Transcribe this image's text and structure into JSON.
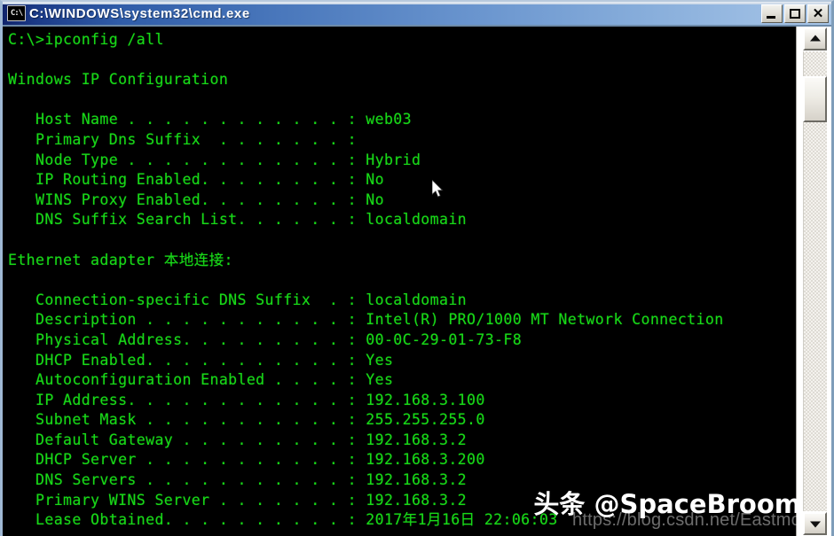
{
  "window": {
    "title": "C:\\WINDOWS\\system32\\cmd.exe",
    "icon_label": "C:\\",
    "buttons": {
      "minimize": "Minimize",
      "maximize": "Maximize",
      "close": "✕"
    }
  },
  "console": {
    "prompt_line": "C:\\>ipconfig /all",
    "text": "C:\\>ipconfig /all\n\nWindows IP Configuration\n\n   Host Name . . . . . . . . . . . . : web03\n   Primary Dns Suffix  . . . . . . . :\n   Node Type . . . . . . . . . . . . : Hybrid\n   IP Routing Enabled. . . . . . . . : No\n   WINS Proxy Enabled. . . . . . . . : No\n   DNS Suffix Search List. . . . . . : localdomain\n\nEthernet adapter 本地连接:\n\n   Connection-specific DNS Suffix  . : localdomain\n   Description . . . . . . . . . . . : Intel(R) PRO/1000 MT Network Connection\n   Physical Address. . . . . . . . . : 00-0C-29-01-73-F8\n   DHCP Enabled. . . . . . . . . . . : Yes\n   Autoconfiguration Enabled . . . . : Yes\n   IP Address. . . . . . . . . . . . : 192.168.3.100\n   Subnet Mask . . . . . . . . . . . : 255.255.255.0\n   Default Gateway . . . . . . . . . : 192.168.3.2\n   DHCP Server . . . . . . . . . . . : 192.168.3.200\n   DNS Servers . . . . . . . . . . . : 192.168.3.2\n   Primary WINS Server . . . . . . . : 192.168.3.2\n   Lease Obtained. . . . . . . . . . : 2017年1月16日 22:06:03",
    "command": "ipconfig /all",
    "section_titles": [
      "Windows IP Configuration",
      "Ethernet adapter 本地连接:"
    ],
    "ip_configuration": [
      {
        "label": "Host Name",
        "value": "web03"
      },
      {
        "label": "Primary Dns Suffix",
        "value": ""
      },
      {
        "label": "Node Type",
        "value": "Hybrid"
      },
      {
        "label": "IP Routing Enabled",
        "value": "No"
      },
      {
        "label": "WINS Proxy Enabled",
        "value": "No"
      },
      {
        "label": "DNS Suffix Search List",
        "value": "localdomain"
      }
    ],
    "ethernet_adapter": [
      {
        "label": "Connection-specific DNS Suffix",
        "value": "localdomain"
      },
      {
        "label": "Description",
        "value": "Intel(R) PRO/1000 MT Network Connection"
      },
      {
        "label": "Physical Address",
        "value": "00-0C-29-01-73-F8"
      },
      {
        "label": "DHCP Enabled",
        "value": "Yes"
      },
      {
        "label": "Autoconfiguration Enabled",
        "value": "Yes"
      },
      {
        "label": "IP Address",
        "value": "192.168.3.100"
      },
      {
        "label": "Subnet Mask",
        "value": "255.255.255.0"
      },
      {
        "label": "Default Gateway",
        "value": "192.168.3.2"
      },
      {
        "label": "DHCP Server",
        "value": "192.168.3.200"
      },
      {
        "label": "DNS Servers",
        "value": "192.168.3.2"
      },
      {
        "label": "Primary WINS Server",
        "value": "192.168.3.2"
      },
      {
        "label": "Lease Obtained",
        "value": "2017年1月16日 22:06:03"
      }
    ],
    "colors": {
      "background": "#000000",
      "text": "#18d818"
    }
  },
  "scrollbar": {
    "up_arrow": "▲",
    "down_arrow": "▼"
  },
  "watermark": {
    "main": "头条 @SpaceBroom",
    "sub": "https://blog.csdn.net/Eastmo"
  }
}
